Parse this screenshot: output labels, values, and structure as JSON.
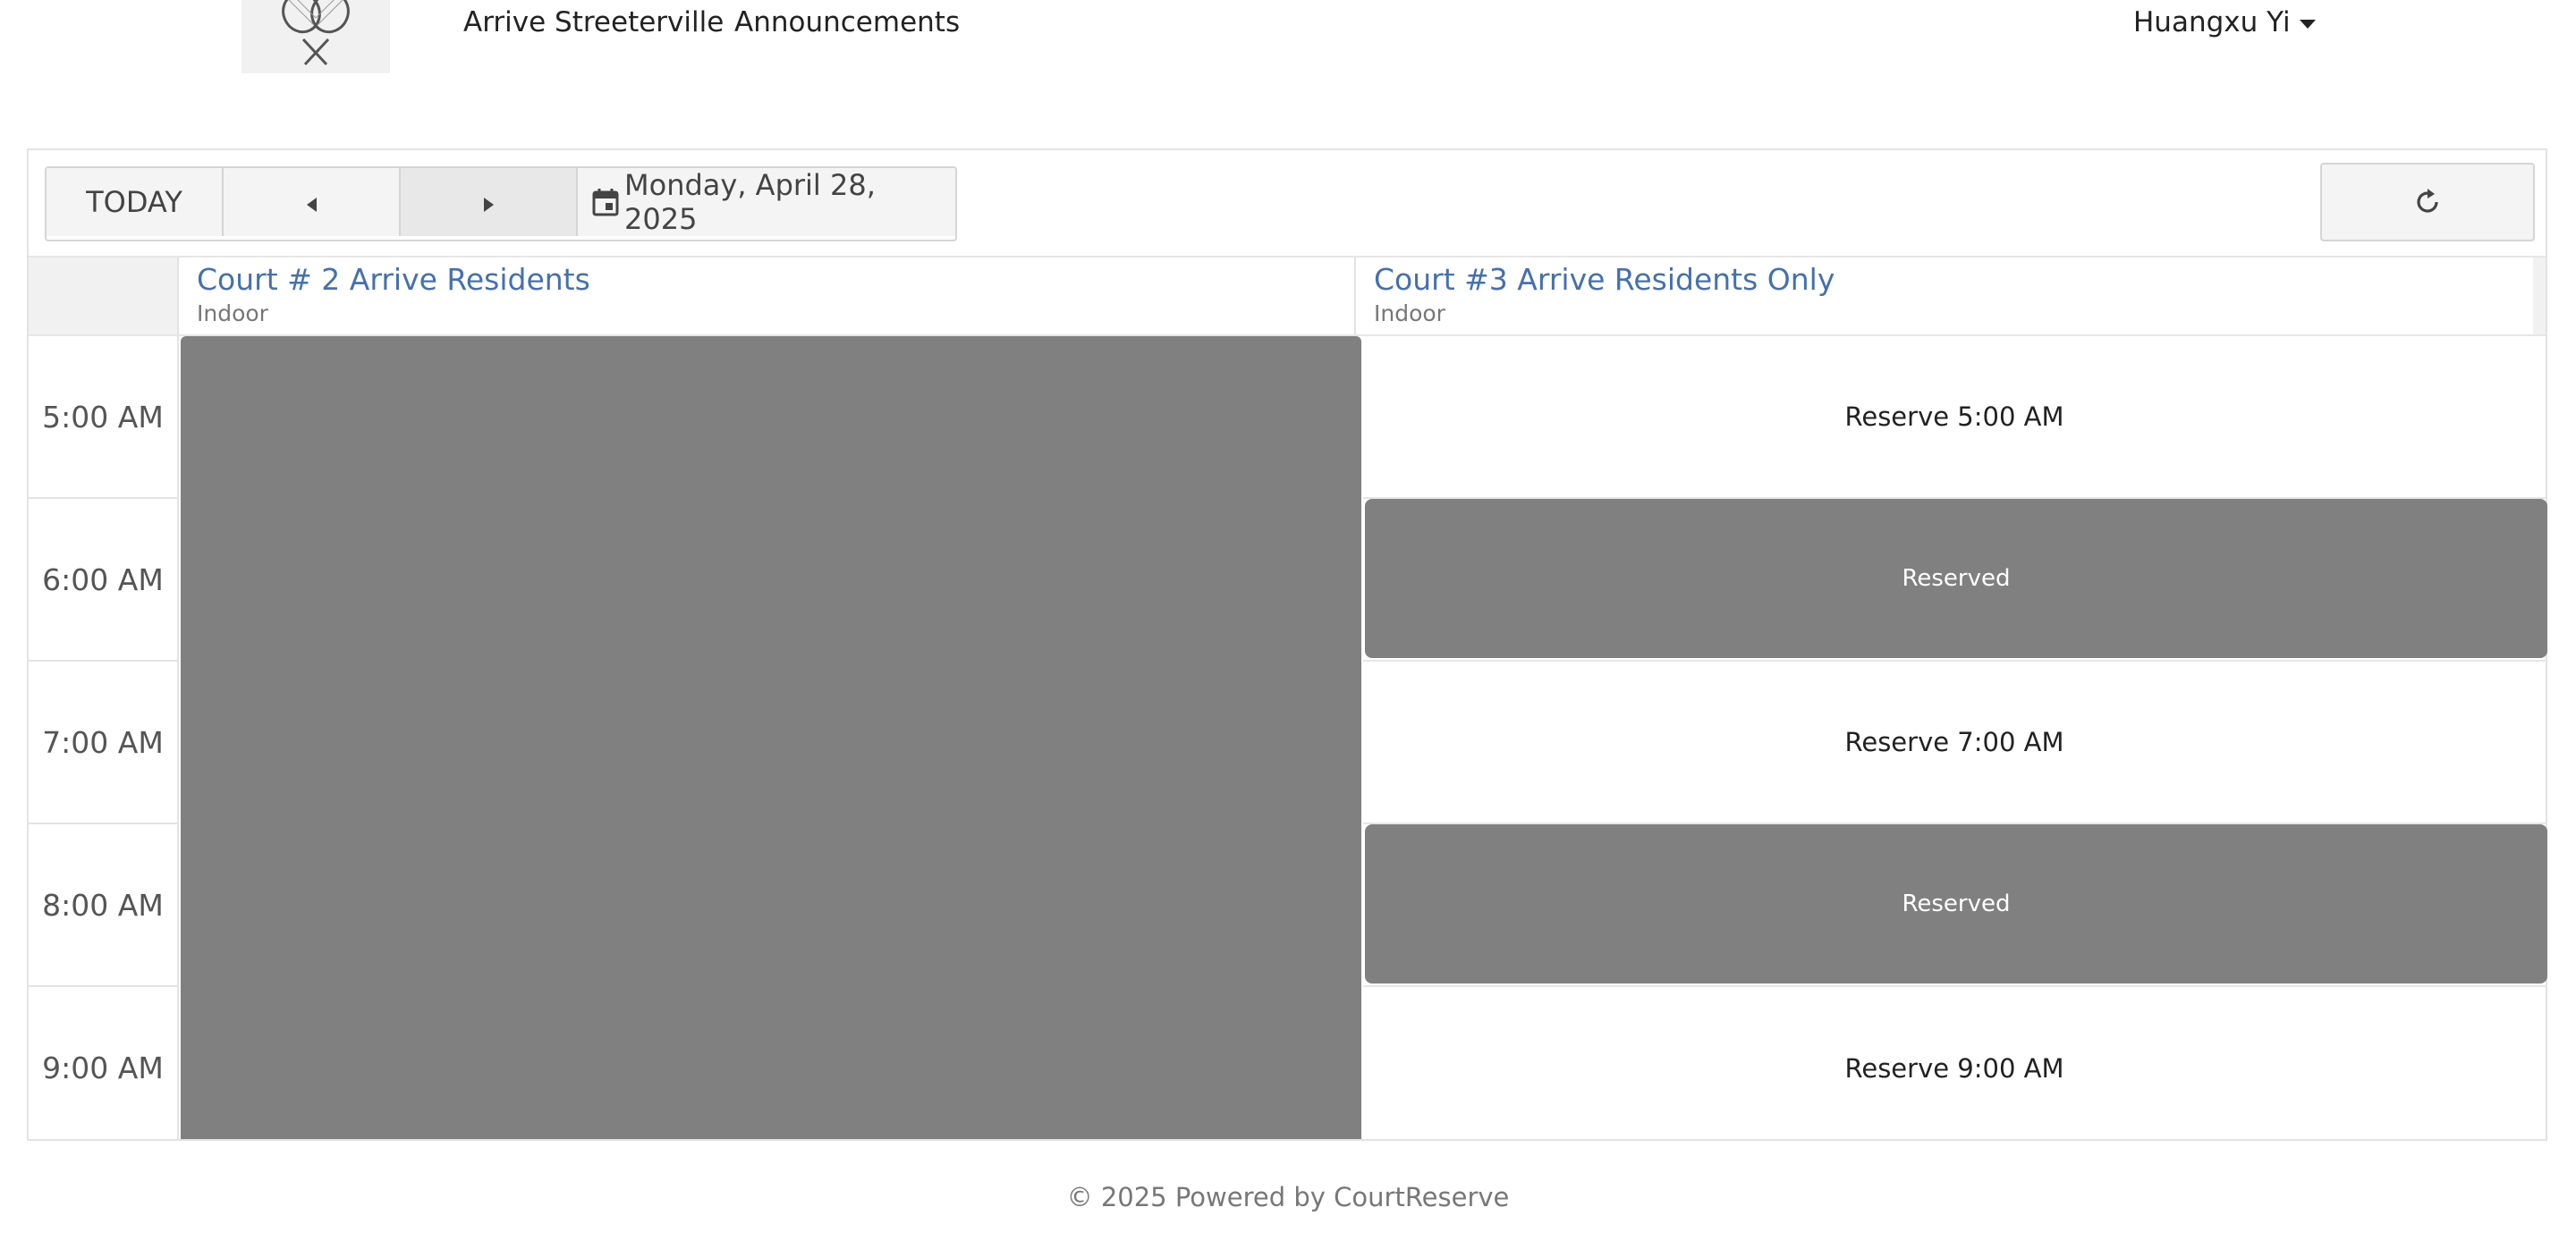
{
  "nav": {
    "links": [
      "Arrive Streeterville",
      "Announcements"
    ],
    "user_name": "Huangxu Yi"
  },
  "toolbar": {
    "today_label": "TODAY",
    "date_label": "Monday, April 28, 2025"
  },
  "courts": [
    {
      "name": "Court # 2 Arrive Residents",
      "type": "Indoor"
    },
    {
      "name": "Court #3 Arrive Residents Only",
      "type": "Indoor"
    }
  ],
  "times": [
    "5:00 AM",
    "6:00 AM",
    "7:00 AM",
    "8:00 AM",
    "9:00 AM"
  ],
  "court3_slots": [
    {
      "label": "Reserve 5:00 AM",
      "status": "available"
    },
    {
      "label": "Reserved",
      "status": "reserved"
    },
    {
      "label": "Reserve 7:00 AM",
      "status": "available"
    },
    {
      "label": "Reserved",
      "status": "reserved"
    },
    {
      "label": "Reserve 9:00 AM",
      "status": "available"
    }
  ],
  "footer": "© 2025 Powered by CourtReserve",
  "colors": {
    "court_link": "#4470b0",
    "reserved_block": "#808080"
  },
  "icons": [
    "tennis-rackets-logo-icon",
    "caret-down-icon",
    "chevron-left-icon",
    "chevron-right-icon",
    "calendar-icon",
    "refresh-icon"
  ]
}
